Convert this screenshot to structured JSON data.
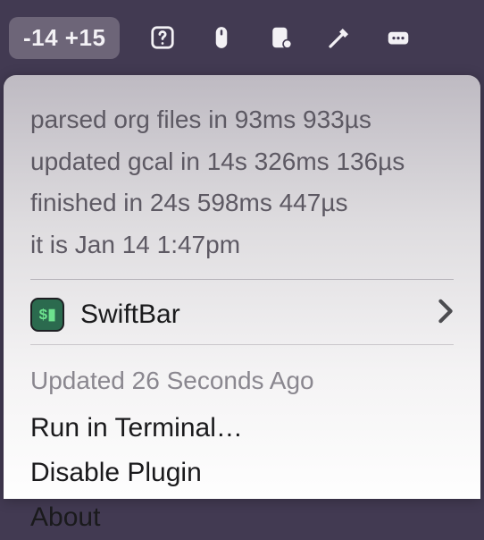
{
  "menubar": {
    "badge": "-14 +15"
  },
  "log": {
    "line1": "parsed org files in 93ms 933µs",
    "line2": "updated gcal in 14s 326ms 136µs",
    "line3": "finished in 24s 598ms 447µs",
    "line4": "it is Jan 14 1:47pm"
  },
  "app": {
    "name": "SwiftBar",
    "icon_text": "$▮"
  },
  "footer": {
    "updated": "Updated 26 Seconds Ago",
    "run": "Run in Terminal…",
    "disable": "Disable Plugin",
    "about": "About"
  }
}
